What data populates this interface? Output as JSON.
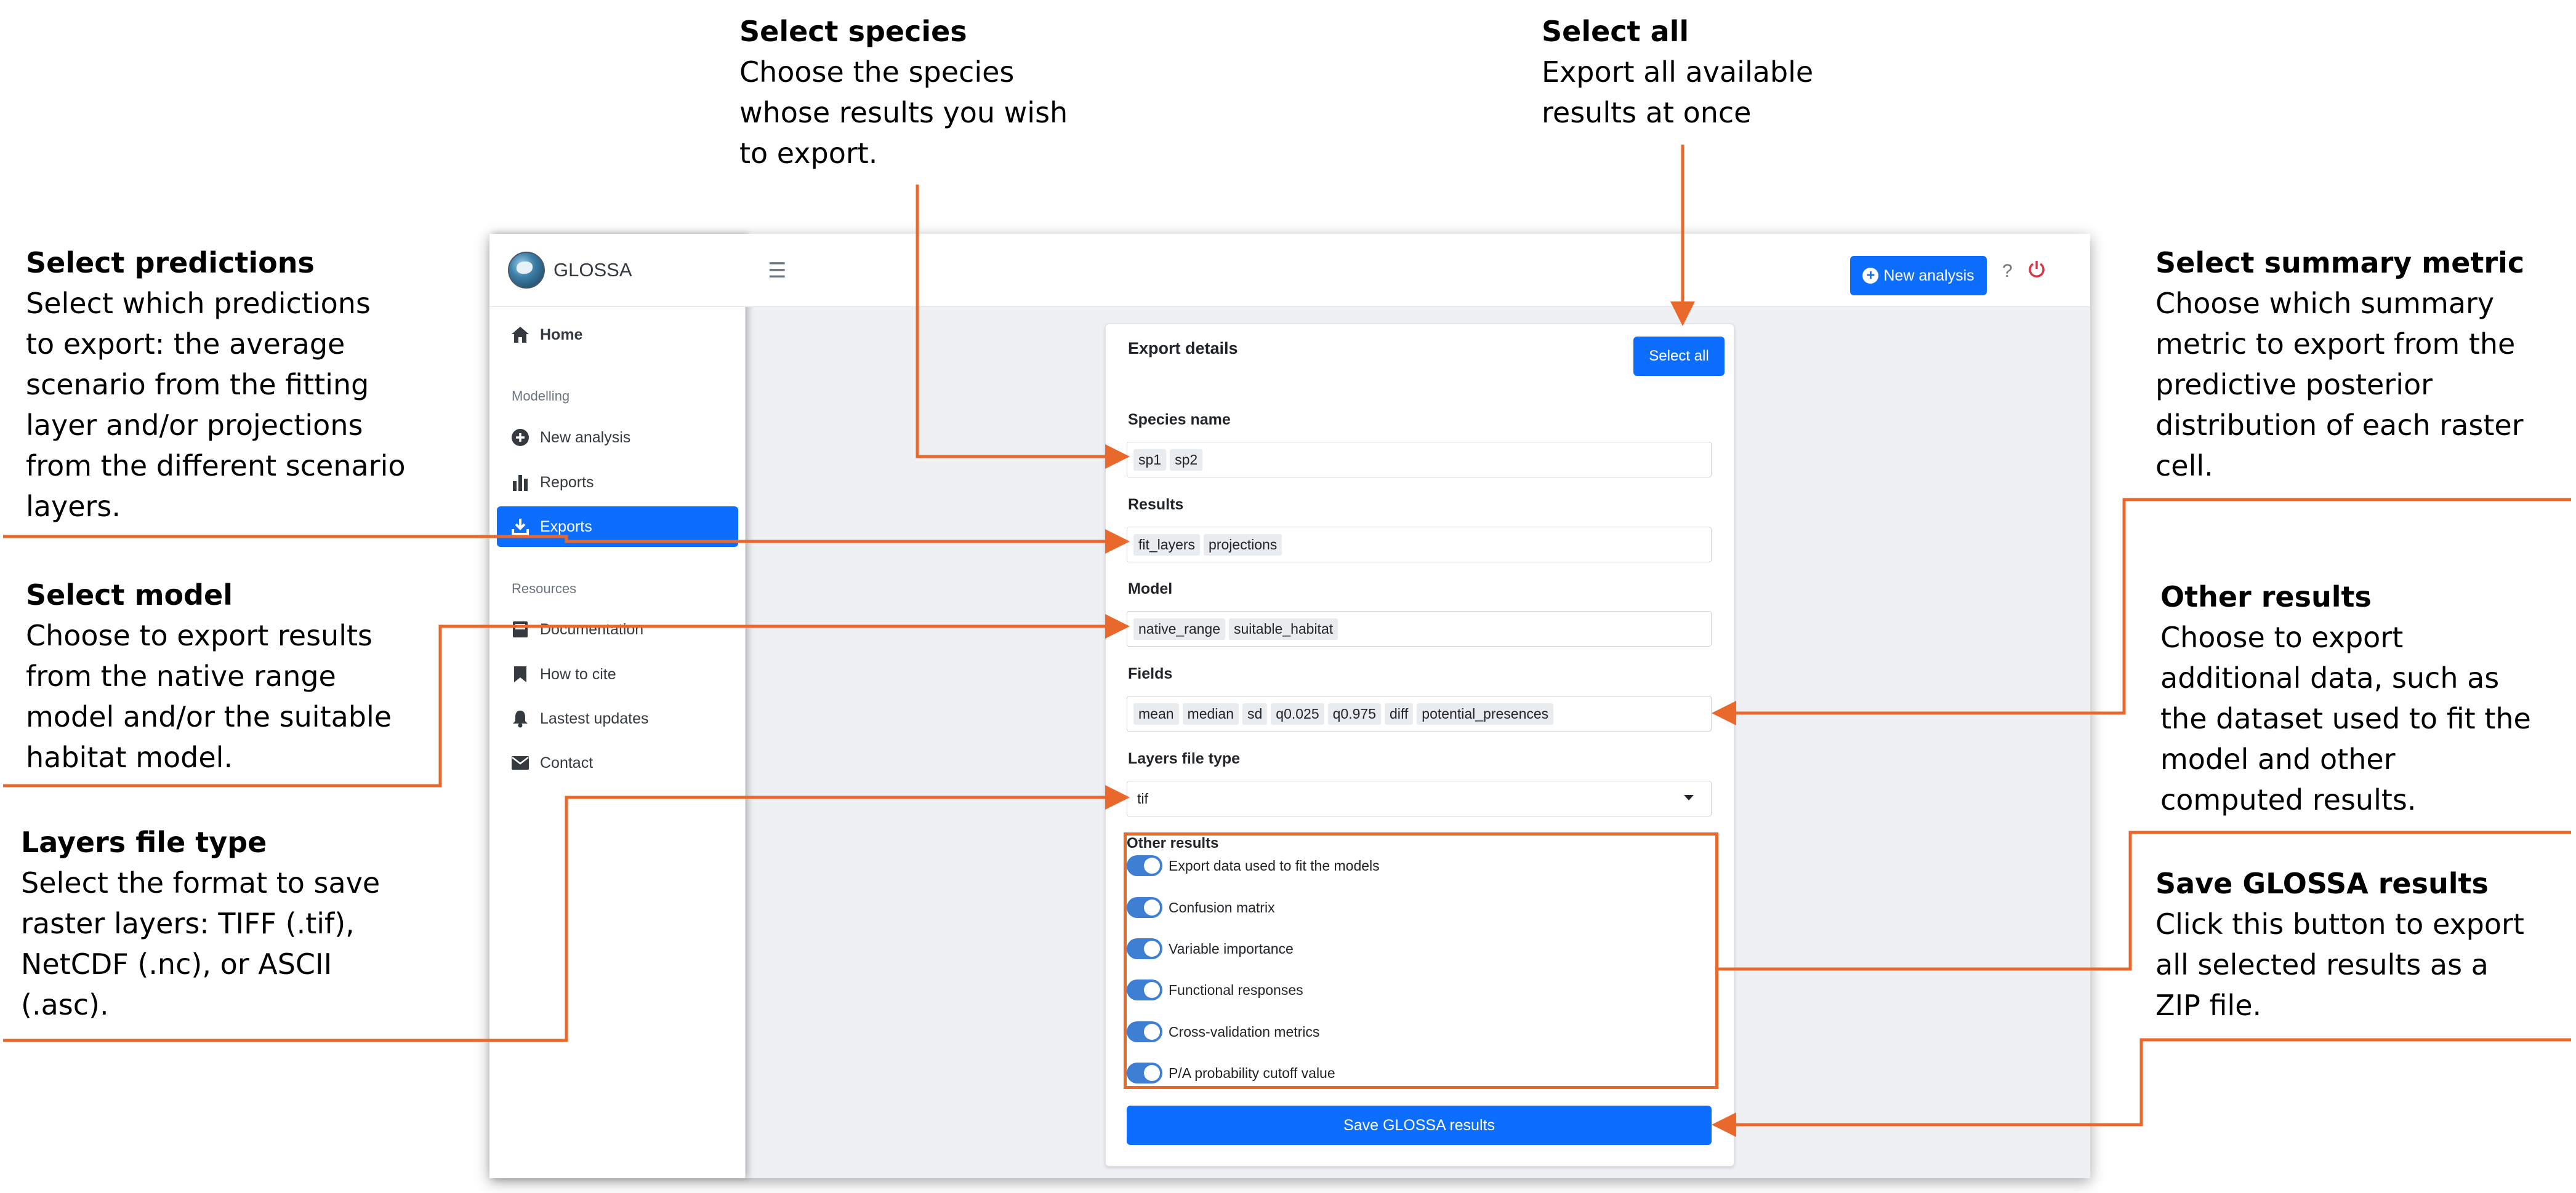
{
  "annotations": {
    "select_species": {
      "title": "Select species",
      "lines": [
        "Choose the species",
        "whose results you wish",
        "to export."
      ]
    },
    "select_all": {
      "title": "Select all",
      "lines": [
        "Export all available",
        "results at once"
      ]
    },
    "select_predictions": {
      "title": "Select predictions",
      "lines": [
        "Select which predictions",
        "to export: the average",
        "scenario from the fitting",
        "layer and/or projections",
        "from the different scenario",
        "layers."
      ]
    },
    "select_model": {
      "title": "Select model",
      "lines": [
        "Choose to export results",
        "from the native range",
        "model and/or the suitable",
        "habitat model."
      ]
    },
    "layers_file_type": {
      "title": "Layers file type",
      "lines": [
        "Select the format to save",
        "raster layers: TIFF (.tif),",
        "NetCDF (.nc), or ASCII",
        "(.asc)."
      ]
    },
    "select_summary_metric": {
      "title": "Select summary metric",
      "lines": [
        "Choose which summary",
        "metric to export from the",
        "predictive posterior",
        "distribution of each raster",
        "cell."
      ]
    },
    "other_results": {
      "title": "Other results",
      "lines": [
        "Choose to export",
        "additional data, such as",
        "the dataset used to fit the",
        "model and other",
        "computed results."
      ]
    },
    "save_results": {
      "title": "Save GLOSSA results",
      "lines": [
        "Click this button to export",
        "all selected results as a",
        "ZIP file."
      ]
    }
  },
  "accent_color": "#e9692c",
  "app": {
    "brand": "GLOSSA",
    "sidebar": {
      "home": {
        "label": "Home",
        "icon": "home-icon"
      },
      "modelling_header": "Modelling",
      "new_analysis": {
        "label": "New analysis",
        "icon": "plus-circle-icon"
      },
      "reports": {
        "label": "Reports",
        "icon": "bar-chart-icon"
      },
      "exports": {
        "label": "Exports",
        "icon": "download-icon"
      },
      "resources_header": "Resources",
      "documentation": {
        "label": "Documentation",
        "icon": "book-icon"
      },
      "how_to_cite": {
        "label": "How to cite",
        "icon": "bookmark-icon"
      },
      "latest_updates": {
        "label": "Lastest updates",
        "icon": "bell-icon"
      },
      "contact": {
        "label": "Contact",
        "icon": "envelope-icon"
      }
    },
    "topbar": {
      "new_analysis": "New analysis",
      "help": "?"
    },
    "export": {
      "title": "Export details",
      "select_all": "Select all",
      "species_label": "Species name",
      "species": [
        "sp1",
        "sp2"
      ],
      "results_label": "Results",
      "results": [
        "fit_layers",
        "projections"
      ],
      "model_label": "Model",
      "models": [
        "native_range",
        "suitable_habitat"
      ],
      "fields_label": "Fields",
      "fields": [
        "mean",
        "median",
        "sd",
        "q0.025",
        "q0.975",
        "diff",
        "potential_presences"
      ],
      "file_type_label": "Layers file type",
      "file_type": "tif",
      "other_label": "Other results",
      "other": [
        "Export data used to fit the models",
        "Confusion matrix",
        "Variable importance",
        "Functional responses",
        "Cross-validation metrics",
        "P/A probability cutoff value"
      ],
      "save": "Save GLOSSA results"
    }
  }
}
